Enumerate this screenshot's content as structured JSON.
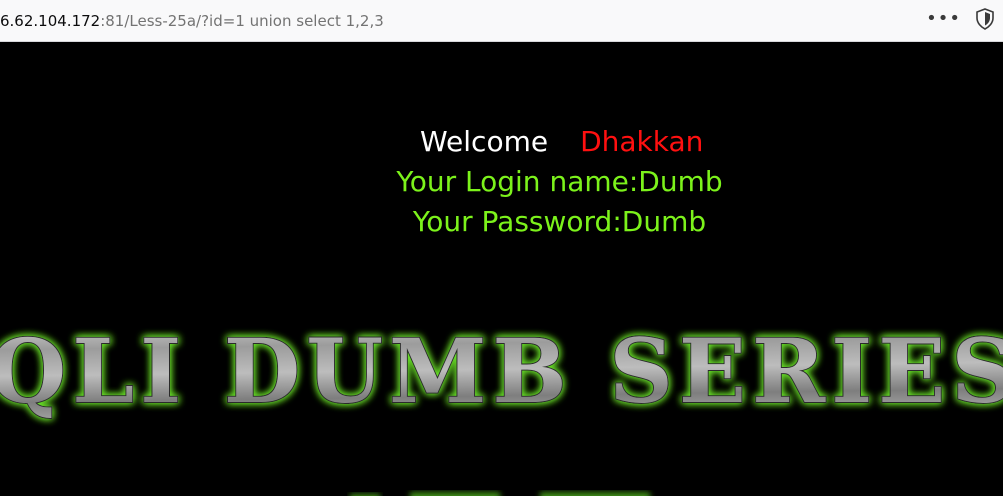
{
  "address_bar": {
    "url_host": "6.62.104.172",
    "url_rest": ":81/Less-25a/?id=1 union select 1,2,3",
    "more_glyph": "•••"
  },
  "page": {
    "welcome": "Welcome",
    "user": "Dhakkan",
    "login_line": "Your Login name:Dumb",
    "password_line": "Your Password:Dumb",
    "banner_text": "SQLI DUMB SERIES"
  },
  "colors": {
    "background": "#000000",
    "welcome": "#ffffff",
    "user": "#ff1010",
    "info": "#7cf21b",
    "glow": "#6be32a"
  }
}
